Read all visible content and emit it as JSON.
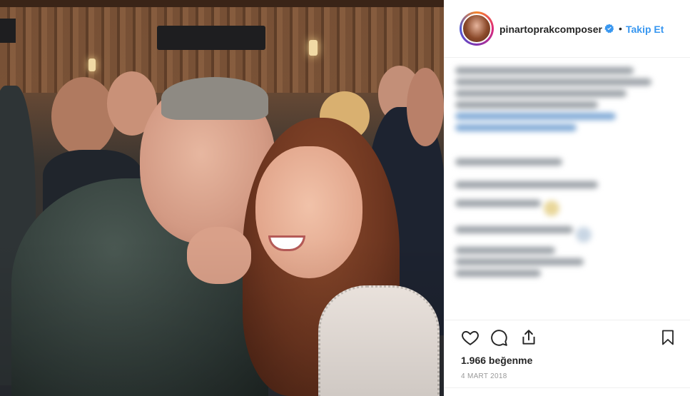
{
  "post": {
    "username": "pinartoprakcomposer",
    "separator": "•",
    "follow_label": "Takip Et",
    "likes_text": "1.966 beğenme",
    "date_text": "4 MART 2018"
  },
  "icons": {
    "verified": "verified-badge-icon",
    "like": "heart-icon",
    "comment": "comment-icon",
    "share": "share-icon",
    "save": "bookmark-icon"
  },
  "colors": {
    "link_blue": "#3897f0",
    "text_dark": "#262626",
    "muted": "#999999",
    "divider": "#efefef"
  }
}
